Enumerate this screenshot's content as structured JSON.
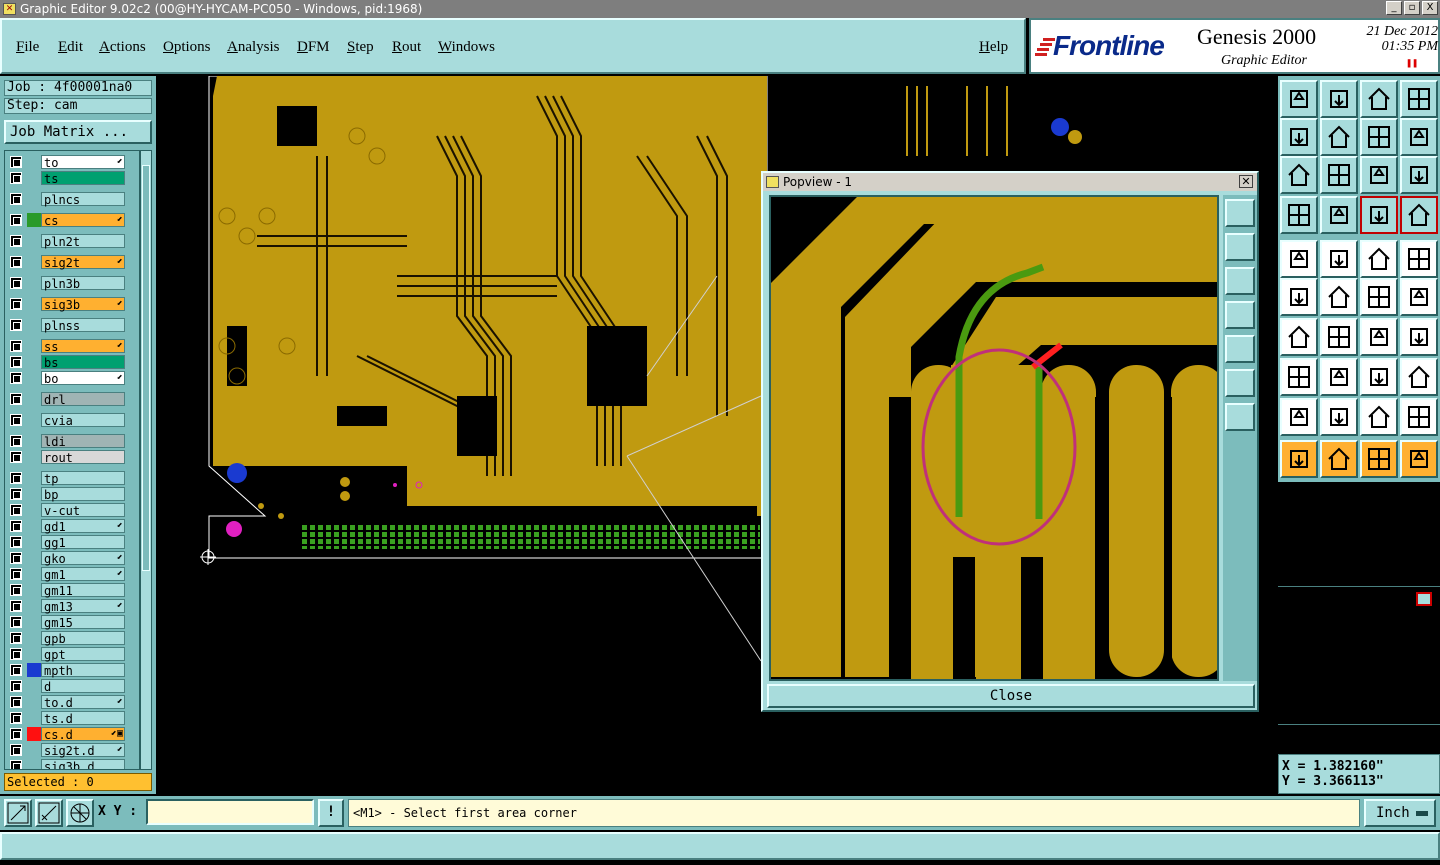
{
  "window": {
    "title": "Graphic Editor 9.02c2 (00@HY-HYCAM-PC050 - Windows, pid:1968)",
    "buttons": [
      "_",
      "▫",
      "X"
    ]
  },
  "menu": [
    "File",
    "Edit",
    "Actions",
    "Options",
    "Analysis",
    "DFM",
    "Step",
    "Rout",
    "Windows",
    "Help"
  ],
  "logo": {
    "brand": "Frontline",
    "product": "Genesis 2000",
    "subtitle": "Graphic Editor",
    "date": "21 Dec 2012",
    "time": "01:35 PM"
  },
  "job": {
    "job_label": "Job : 4f00001na0",
    "step_label": "Step: cam",
    "matrix_button": "Job Matrix ..."
  },
  "layers": [
    {
      "name": "to",
      "color": "#ffffff",
      "swatch": "",
      "mark": "⬋"
    },
    {
      "name": "ts",
      "color": "#00a070",
      "swatch": "",
      "mark": ""
    },
    {
      "name": "plncs",
      "color": "#a8dcdc",
      "swatch": "",
      "mark": ""
    },
    {
      "name": "cs",
      "color": "#ffb030",
      "swatch": "#2a9a2a",
      "mark": "⬋"
    },
    {
      "name": "pln2t",
      "color": "#a8dcdc",
      "swatch": "",
      "mark": ""
    },
    {
      "name": "sig2t",
      "color": "#ffb030",
      "swatch": "",
      "mark": "⬋"
    },
    {
      "name": "pln3b",
      "color": "#a8dcdc",
      "swatch": "",
      "mark": ""
    },
    {
      "name": "sig3b",
      "color": "#ffb030",
      "swatch": "",
      "mark": "⬋"
    },
    {
      "name": "plnss",
      "color": "#a8dcdc",
      "swatch": "",
      "mark": ""
    },
    {
      "name": "ss",
      "color": "#ffb030",
      "swatch": "",
      "mark": "⬋"
    },
    {
      "name": "bs",
      "color": "#00a070",
      "swatch": "",
      "mark": ""
    },
    {
      "name": "bo",
      "color": "#ffffff",
      "swatch": "",
      "mark": "⬋"
    },
    {
      "name": "drl",
      "color": "#a0b4b4",
      "swatch": "",
      "mark": ""
    },
    {
      "name": "cvia",
      "color": "#a8dcdc",
      "swatch": "",
      "mark": ""
    },
    {
      "name": "ldi",
      "color": "#a0b4b4",
      "swatch": "",
      "mark": ""
    },
    {
      "name": "rout",
      "color": "#d8d8d8",
      "swatch": "",
      "mark": ""
    },
    {
      "name": "tp",
      "color": "#a8dcdc",
      "swatch": "",
      "mark": ""
    },
    {
      "name": "bp",
      "color": "#a8dcdc",
      "swatch": "",
      "mark": ""
    },
    {
      "name": "v-cut",
      "color": "#a8dcdc",
      "swatch": "",
      "mark": ""
    },
    {
      "name": "gd1",
      "color": "#a8dcdc",
      "swatch": "",
      "mark": "⬋"
    },
    {
      "name": "gg1",
      "color": "#a8dcdc",
      "swatch": "",
      "mark": ""
    },
    {
      "name": "gko",
      "color": "#a8dcdc",
      "swatch": "",
      "mark": "⬋"
    },
    {
      "name": "gm1",
      "color": "#a8dcdc",
      "swatch": "",
      "mark": "⬋"
    },
    {
      "name": "gm11",
      "color": "#a8dcdc",
      "swatch": "",
      "mark": ""
    },
    {
      "name": "gm13",
      "color": "#a8dcdc",
      "swatch": "",
      "mark": "⬋"
    },
    {
      "name": "gm15",
      "color": "#a8dcdc",
      "swatch": "",
      "mark": ""
    },
    {
      "name": "gpb",
      "color": "#a8dcdc",
      "swatch": "",
      "mark": ""
    },
    {
      "name": "gpt",
      "color": "#a8dcdc",
      "swatch": "",
      "mark": ""
    },
    {
      "name": "mpth",
      "color": "#a8dcdc",
      "swatch": "#1a3ad0",
      "mark": ""
    },
    {
      "name": "d",
      "color": "#a8dcdc",
      "swatch": "",
      "mark": ""
    },
    {
      "name": "to.d",
      "color": "#a8dcdc",
      "swatch": "",
      "mark": "⬋"
    },
    {
      "name": "ts.d",
      "color": "#a8dcdc",
      "swatch": "",
      "mark": ""
    },
    {
      "name": "cs.d",
      "color": "#ffb030",
      "swatch": "#ff1010",
      "mark": "⬋▣"
    },
    {
      "name": "sig2t.d",
      "color": "#a8dcdc",
      "swatch": "",
      "mark": "⬋"
    },
    {
      "name": "sig3b.d",
      "color": "#a8dcdc",
      "swatch": "",
      "mark": ""
    }
  ],
  "selected_label": "Selected : 0",
  "popview": {
    "title": "Popview - 1",
    "close_label": "Close"
  },
  "coords": {
    "x": "X = 1.382160\"",
    "y": "Y = 3.366113\""
  },
  "bottombar": {
    "xy_label": "X Y :",
    "xy_value": "",
    "warn_label": "!",
    "prompt": "<M1> - Select first area corner",
    "unit": "Inch"
  },
  "colors": {
    "copper": "#c09a10",
    "panel": "#a8dcdc",
    "panel_dark": "#7cbcbc",
    "highlight_green": "#4a9a10",
    "marker_red": "#ff2020",
    "ellipse": "#c0307a"
  }
}
